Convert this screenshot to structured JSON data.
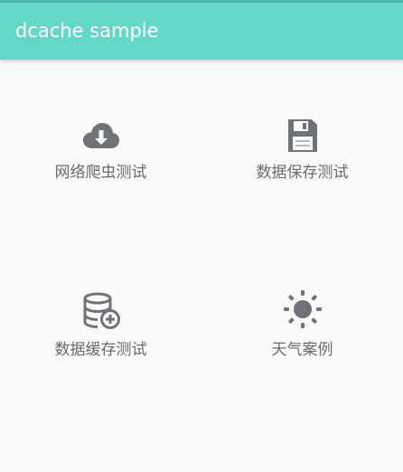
{
  "app_bar": {
    "title": "dcache sample",
    "background": "#64d8c6",
    "title_color": "#ffffff"
  },
  "menu": {
    "items": [
      {
        "label": "网络爬虫测试",
        "icon": "cloud-download-icon"
      },
      {
        "label": "数据保存测试",
        "icon": "floppy-disk-icon"
      },
      {
        "label": "数据缓存测试",
        "icon": "database-add-icon"
      },
      {
        "label": "天气案例",
        "icon": "sun-icon"
      }
    ],
    "icon_color": "#6f7378",
    "label_color": "#6b6b6b"
  }
}
